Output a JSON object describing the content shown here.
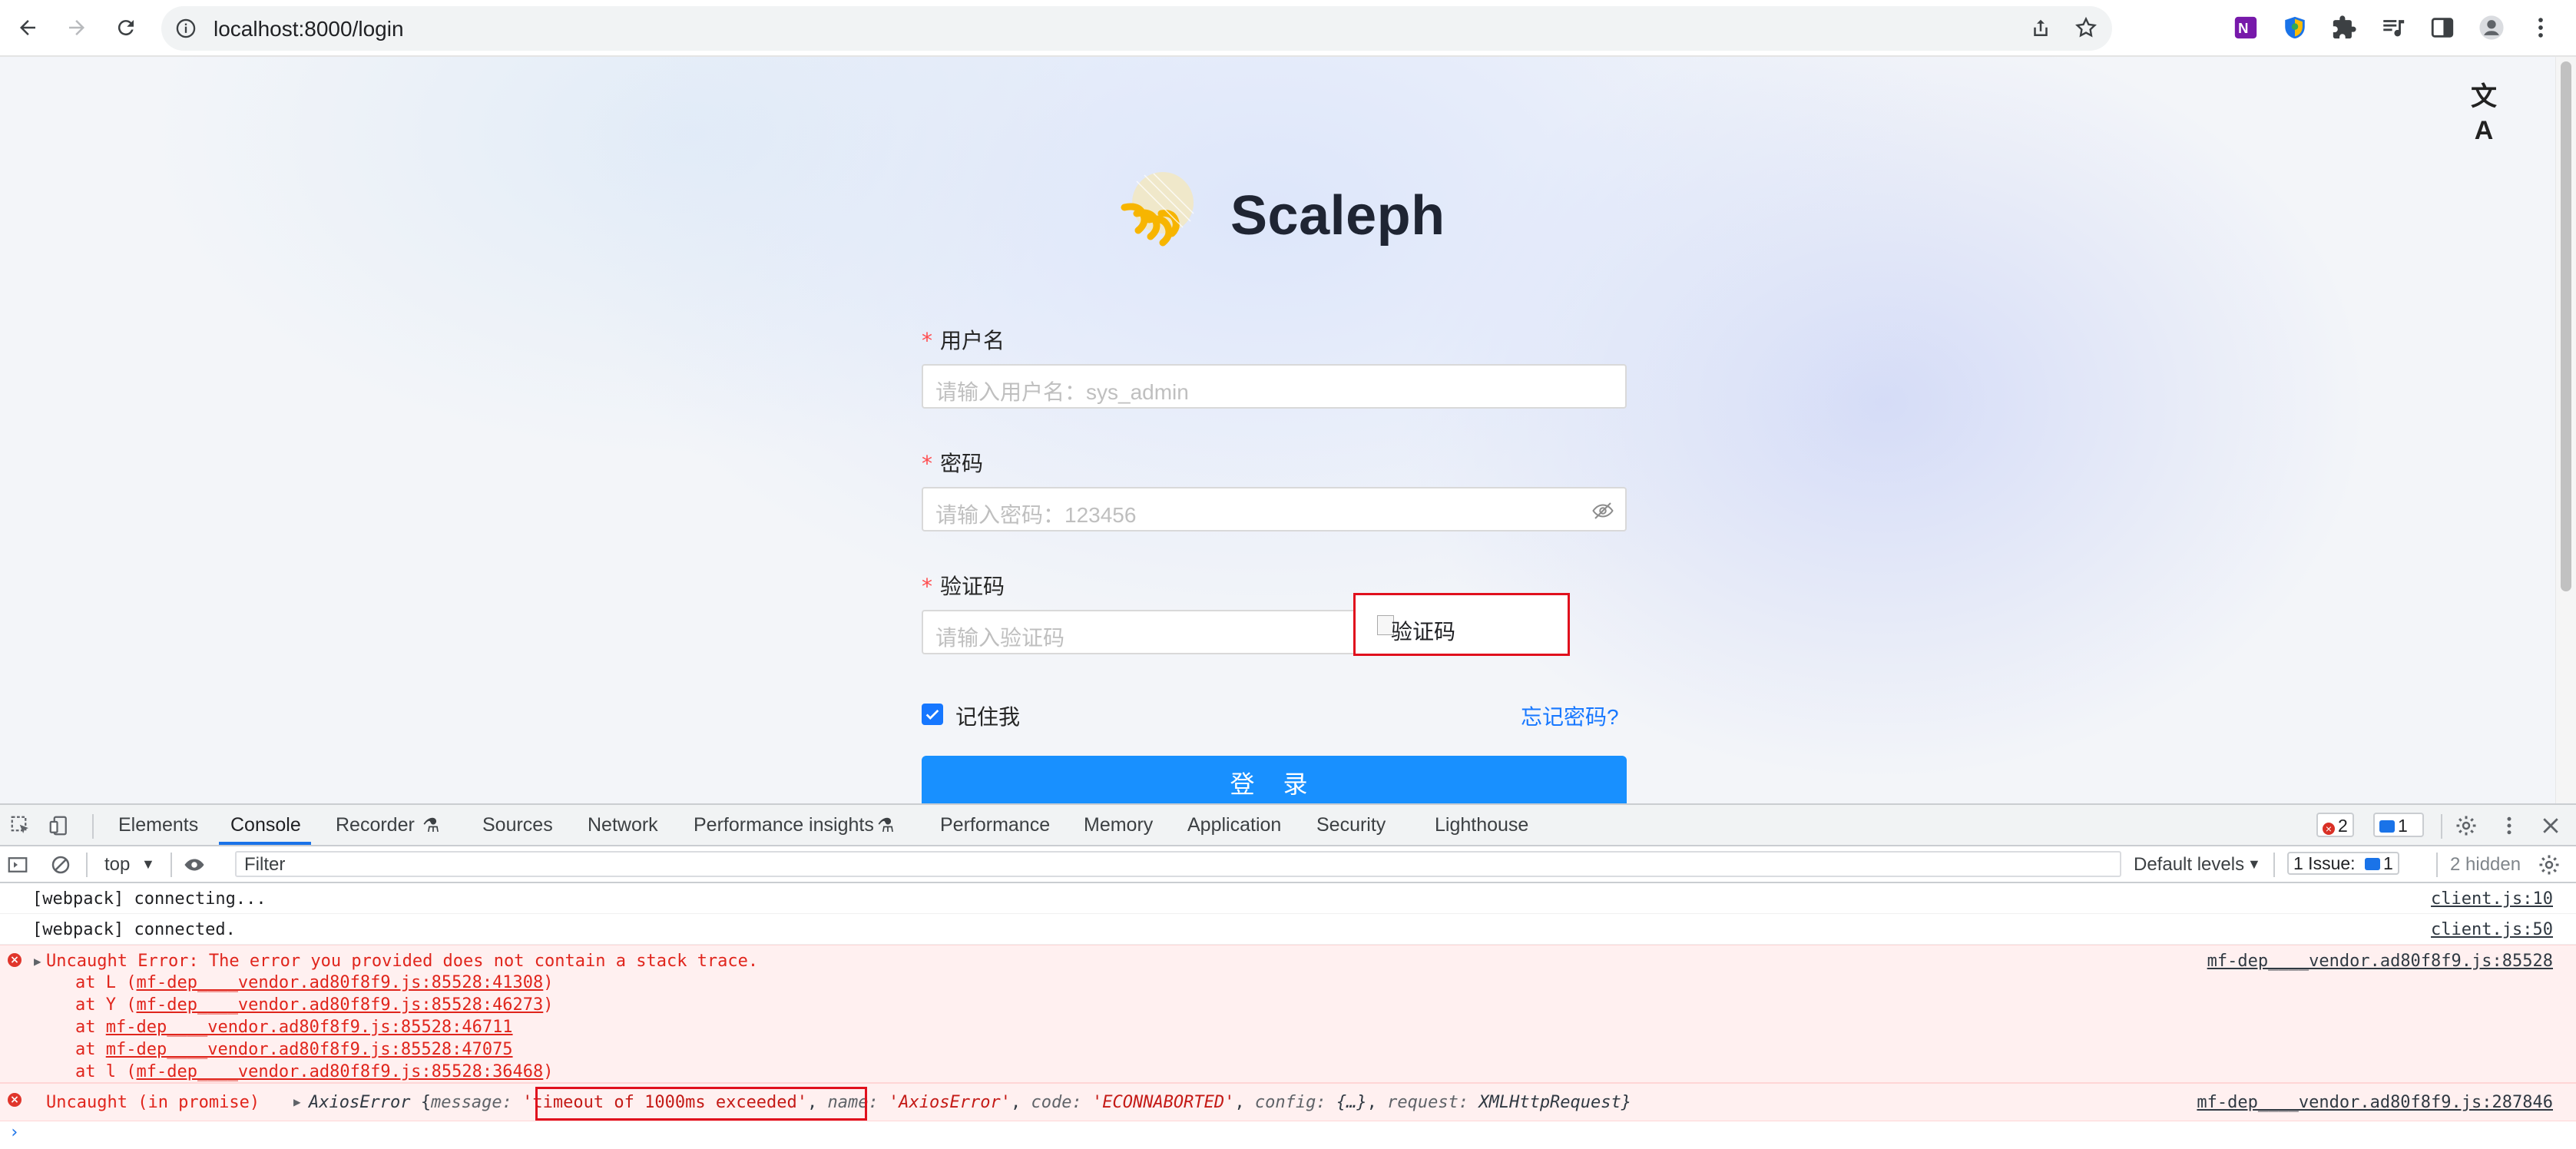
{
  "browser": {
    "url": "localhost:8000/login",
    "icons": [
      "back-icon",
      "forward-icon",
      "reload-icon",
      "site-info-icon",
      "share-icon",
      "bookmark-star-icon",
      "onenote-extension-icon",
      "shield-extension-icon",
      "extensions-puzzle-icon",
      "media-queue-icon",
      "side-panel-icon",
      "profile-avatar-icon",
      "chrome-menu-icon"
    ]
  },
  "page": {
    "brand": "Scaleph",
    "lang_icon": "文A",
    "username": {
      "label": "用户名",
      "placeholder": "请输入用户名：sys_admin"
    },
    "password": {
      "label": "密码",
      "placeholder": "请输入密码：123456"
    },
    "captcha": {
      "label": "验证码",
      "placeholder": "请输入验证码",
      "image_alt": "验证码"
    },
    "required_mark": "*",
    "remember": "记住我",
    "forgot": "忘记密码?",
    "submit": "登 录",
    "colors": {
      "primary": "#1890ff",
      "required": "#ff4d4f",
      "highlight": "#e0101d"
    }
  },
  "devtools": {
    "tabs": [
      "Elements",
      "Console",
      "Recorder",
      "Sources",
      "Network",
      "Performance insights",
      "Performance",
      "Memory",
      "Application",
      "Security",
      "Lighthouse"
    ],
    "active_tab": "Console",
    "error_count": "2",
    "message_count": "1",
    "context": "top",
    "filter_placeholder": "Filter",
    "levels": "Default levels",
    "issues_label": "1 Issue:",
    "issues_count": "1",
    "hidden": "2 hidden",
    "logs": [
      {
        "message": "[webpack] connecting...",
        "source": "client.js:10"
      },
      {
        "message": "[webpack] connected.",
        "source": "client.js:50"
      }
    ],
    "error1": {
      "message": "Uncaught Error: The error you provided does not contain a stack trace.",
      "source": "mf-dep____vendor.ad80f8f9.js:85528",
      "stack": [
        {
          "prefix": "at L (",
          "link": "mf-dep____vendor.ad80f8f9.js:85528:41308",
          "suffix": ")"
        },
        {
          "prefix": "at Y (",
          "link": "mf-dep____vendor.ad80f8f9.js:85528:46273",
          "suffix": ")"
        },
        {
          "prefix": "at ",
          "link": "mf-dep____vendor.ad80f8f9.js:85528:46711",
          "suffix": ""
        },
        {
          "prefix": "at ",
          "link": "mf-dep____vendor.ad80f8f9.js:85528:47075",
          "suffix": ""
        },
        {
          "prefix": "at l (",
          "link": "mf-dep____vendor.ad80f8f9.js:85528:36468",
          "suffix": ")"
        }
      ]
    },
    "error2": {
      "prefix": "Uncaught (in promise)",
      "obj_name": "AxiosError",
      "open": "{",
      "message_key": "message:",
      "message_value": "'timeout of 1000ms exceeded'",
      "name_key": "name:",
      "name_value": "'AxiosError'",
      "code_key": "code:",
      "code_value": "'ECONNABORTED'",
      "config_key": "config:",
      "config_value": "{…}",
      "request_key": "request:",
      "request_value": "XMLHttpRequest}",
      "source": "mf-dep____vendor.ad80f8f9.js:287846"
    }
  }
}
